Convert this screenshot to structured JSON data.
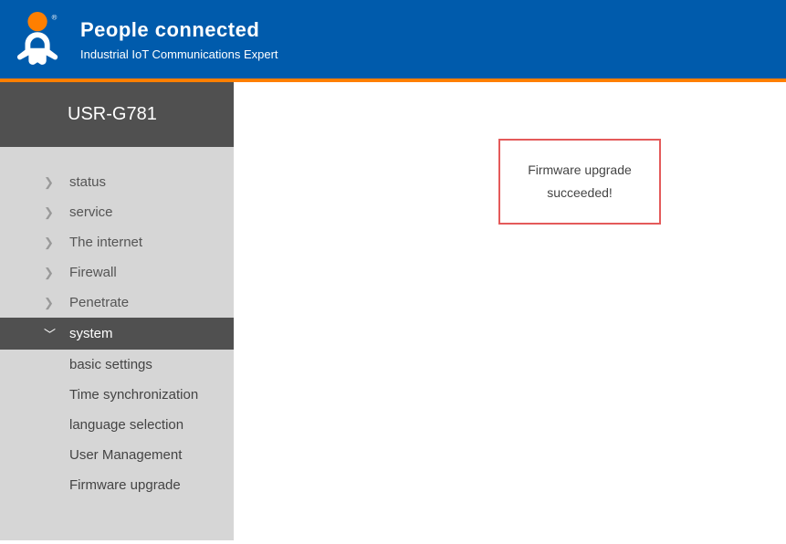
{
  "brand": {
    "title": "People connected",
    "subtitle": "Industrial IoT Communications Expert"
  },
  "device_title": "USR-G781",
  "nav": [
    {
      "label": "status",
      "expanded": false
    },
    {
      "label": "service",
      "expanded": false
    },
    {
      "label": "The internet",
      "expanded": false
    },
    {
      "label": "Firewall",
      "expanded": false
    },
    {
      "label": "Penetrate",
      "expanded": false
    },
    {
      "label": "system",
      "expanded": true,
      "active": true
    }
  ],
  "sub_nav": [
    {
      "label": "basic settings"
    },
    {
      "label": "Time synchronization"
    },
    {
      "label": "language selection"
    },
    {
      "label": "User Management"
    },
    {
      "label": "Firmware upgrade"
    }
  ],
  "message": "Firmware upgrade succeeded!",
  "colors": {
    "header": "#005bac",
    "accent": "#ff7f00",
    "sidebar_bg": "#d6d6d6",
    "sidebar_active": "#505050",
    "alert_border": "#e45a5a"
  }
}
